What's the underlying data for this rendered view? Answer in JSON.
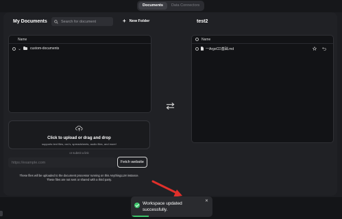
{
  "tabs": [
    {
      "label": "Documents",
      "active": true
    },
    {
      "label": "Data Connectors",
      "active": false
    }
  ],
  "left": {
    "title": "My Documents",
    "search_placeholder": "Search for document",
    "new_folder_label": "New Folder",
    "column_name": "Name",
    "items": [
      {
        "name": "custom-documents",
        "type": "folder"
      }
    ]
  },
  "upload": {
    "title": "Click to upload or drag and drop",
    "subtitle": "supports text files, csv's, spreadsheets, audio files, and more!"
  },
  "link": {
    "or_text": "or submit a link",
    "url_placeholder": "https://example.com",
    "fetch_label": "Fetch website"
  },
  "disclaimer": {
    "line1": "These files will be uploaded to the document processor running on this AnythingLLM instance.",
    "line2": "These files are not sent or shared with a third party."
  },
  "right": {
    "title": "test2",
    "column_name": "Name",
    "items": [
      {
        "name": "一ArgoCD基础.md",
        "type": "file"
      }
    ]
  },
  "toast": {
    "message": "Workspace updated successfully.",
    "close_icon": "close-icon",
    "progress": 0.22,
    "color": "#3ec76d"
  },
  "icons": {
    "swap": "swap-arrows-icon",
    "upload": "cloud-upload-icon",
    "search": "search-icon"
  },
  "colors": {
    "background": "#1c1d21",
    "modal": "#202125",
    "panel": "#121316",
    "success": "#3ec76d",
    "annotation_arrow": "#e0302b"
  }
}
